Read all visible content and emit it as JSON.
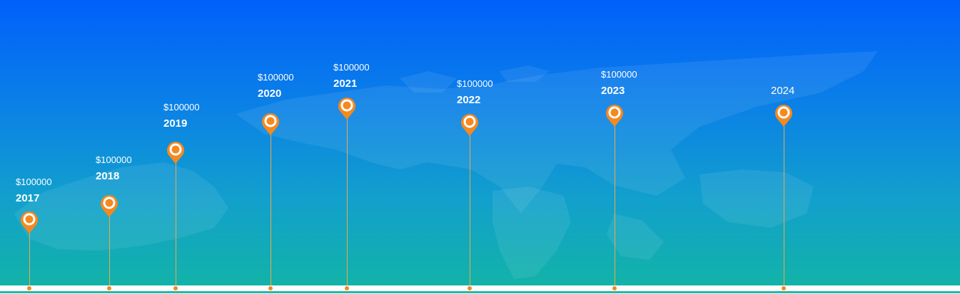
{
  "timeline": {
    "accent_color": "#f5891f",
    "milestones": [
      {
        "year": "2017",
        "amount": "$100000"
      },
      {
        "year": "2018",
        "amount": "$100000"
      },
      {
        "year": "2019",
        "amount": "$100000"
      },
      {
        "year": "2020",
        "amount": "$100000"
      },
      {
        "year": "2021",
        "amount": "$100000"
      },
      {
        "year": "2022",
        "amount": "$100000"
      },
      {
        "year": "2023",
        "amount": "$100000"
      },
      {
        "year": "2024",
        "amount": ""
      }
    ]
  }
}
